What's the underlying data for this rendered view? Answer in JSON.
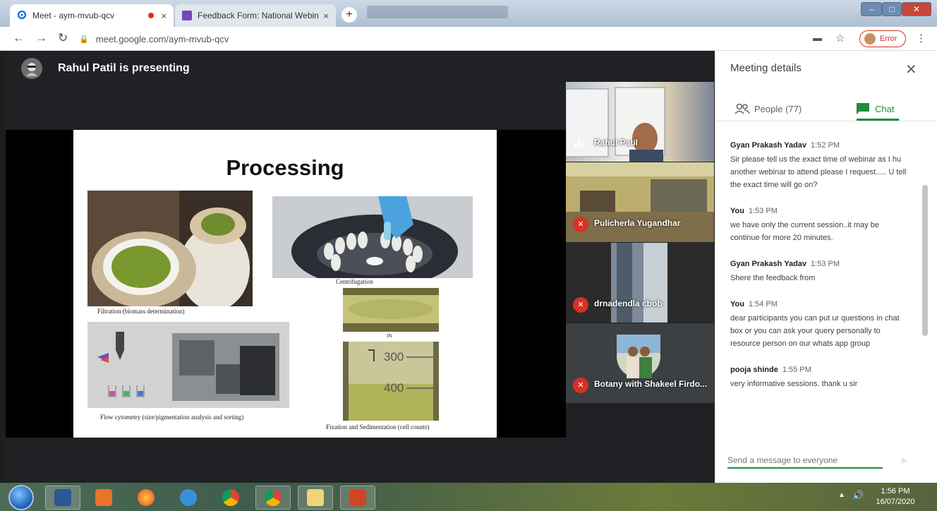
{
  "browser": {
    "tabs": [
      {
        "label": "Meet - aym-mvub-qcv",
        "close": "×"
      },
      {
        "label": "Feedback Form: National Webin",
        "close": "×"
      }
    ],
    "new_tab": "+",
    "url": "meet.google.com/aym-mvub-qcv",
    "profile_status": "Error",
    "icons": [
      "back-icon",
      "forward-icon",
      "reload-icon",
      "lock-icon",
      "camera-icon",
      "star-icon",
      "menu-icon"
    ]
  },
  "meet": {
    "presenter_text": "Rahul Patil is presenting",
    "slide": {
      "title": "Processing",
      "captions": {
        "filtration": "Filtration (biomass determination)",
        "centrifugation": "Centrifugation",
        "in": "IN",
        "flow": "Flow cytometry (size/pigmentation analysis and sorting)",
        "fixation": "Fixation and Sedimentation (cell counts)",
        "cyl_300": "300",
        "cyl_400": "400"
      }
    },
    "participants": [
      {
        "name": "Rahul Patil",
        "muted": false
      },
      {
        "name": "Pulicherla Yugandhar",
        "muted": true
      },
      {
        "name": "drnadendla cbob",
        "muted": true
      },
      {
        "name": "Botany with Shakeel Firdo...",
        "muted": true
      }
    ]
  },
  "panel": {
    "title": "Meeting details",
    "tabs": {
      "people": "People (77)",
      "chat": "Chat"
    },
    "active_tab": "chat",
    "messages": [
      {
        "author": "Gyan Prakash Yadav",
        "time": "1:52 PM",
        "text": "Sir please tell us the exact time of webinar as I hu another webinar to attend please I request..... U tell the exact time will go on?"
      },
      {
        "author": "You",
        "time": "1:53 PM",
        "text": "we have only the current session..it may be continue for more 20 minutes."
      },
      {
        "author": "Gyan Prakash Yadav",
        "time": "1:53 PM",
        "text": "Shere the feedback from"
      },
      {
        "author": "You",
        "time": "1:54 PM",
        "text": "dear participants you can put ur questions in chat box or you can ask your query personally to resource person on our whats app group"
      },
      {
        "author": "pooja shinde",
        "time": "1:55 PM",
        "text": "very informative sessions. thank u sir"
      }
    ],
    "composer_placeholder": "Send a message to everyone"
  },
  "taskbar": {
    "time": "1:56 PM",
    "date": "16/07/2020",
    "apps": [
      "word-icon",
      "presentation-icon",
      "firefox-icon",
      "ie-icon",
      "chrome-icon",
      "chrome-profile-icon",
      "file-explorer-icon",
      "powerpoint-icon"
    ]
  },
  "colors": {
    "meet_green": "#1e8e3e",
    "mute_red": "#d93025",
    "stage": "#202124"
  }
}
